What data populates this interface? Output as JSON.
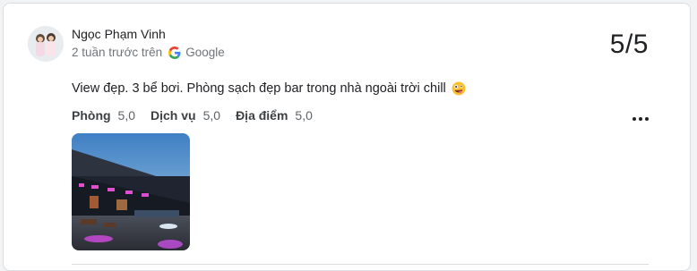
{
  "review": {
    "author": "Ngọc Phạm Vinh",
    "time": "2 tuần trước trên",
    "source": "Google",
    "score": "5/5",
    "text": "View đẹp. 3 bể bơi. Phòng sạch đẹp bar trong nhà ngoài trời chill",
    "emoji_icon": "zany-face-emoji",
    "ratings": [
      {
        "label": "Phòng",
        "value": "5,0"
      },
      {
        "label": "Dịch vụ",
        "value": "5,0"
      },
      {
        "label": "Địa điểm",
        "value": "5,0"
      }
    ],
    "photo_icon": "hotel-bar-photo"
  },
  "colors": {
    "text": "#202124",
    "secondary": "#70757a",
    "border": "#dadce0"
  }
}
